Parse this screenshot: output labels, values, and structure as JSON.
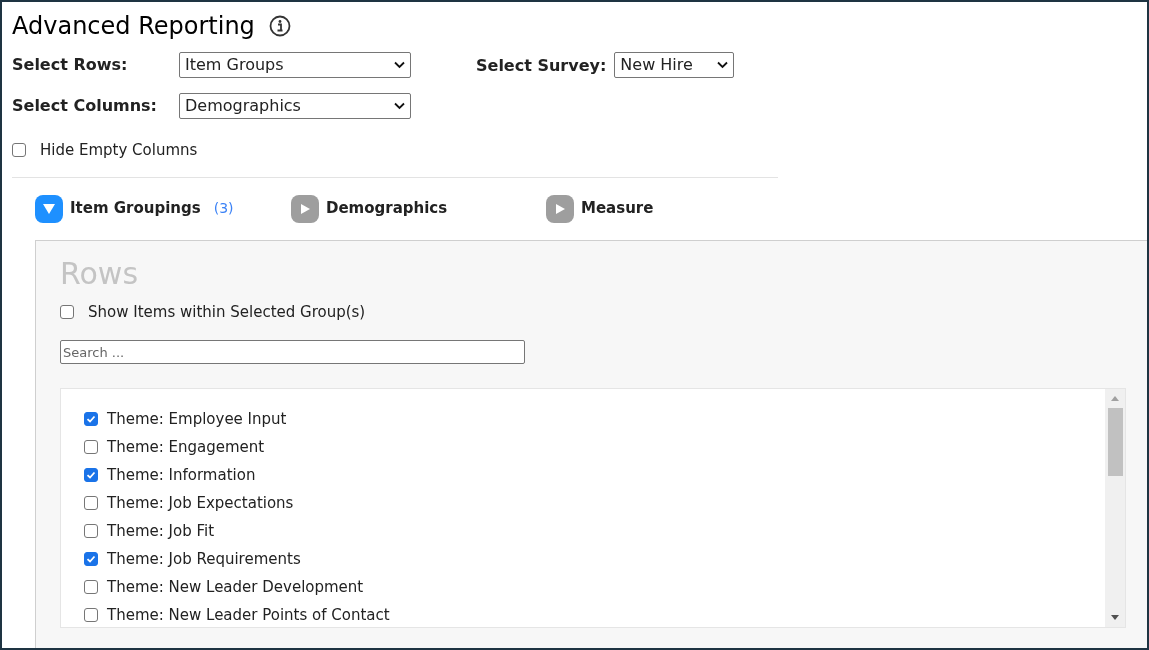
{
  "title": "Advanced Reporting",
  "selectors": [
    {
      "label": "Select Rows:",
      "value": "Item Groups"
    },
    {
      "label": "Select Columns:",
      "value": "Demographics"
    }
  ],
  "survey": {
    "label": "Select Survey:",
    "value": "New Hire"
  },
  "hide_empty_columns": {
    "label": "Hide Empty Columns",
    "checked": false
  },
  "tabs": [
    {
      "label": "Item Groupings",
      "count": "(3)",
      "expanded": true
    },
    {
      "label": "Demographics",
      "expanded": false
    },
    {
      "label": "Measure",
      "expanded": false
    }
  ],
  "panel": {
    "heading": "Rows",
    "show_items": {
      "label": "Show Items within Selected Group(s)",
      "checked": false
    },
    "search": {
      "placeholder": "Search ..."
    },
    "items": [
      {
        "label": "Theme: Employee Input",
        "checked": true
      },
      {
        "label": "Theme: Engagement",
        "checked": false
      },
      {
        "label": "Theme: Information",
        "checked": true
      },
      {
        "label": "Theme: Job Expectations",
        "checked": false
      },
      {
        "label": "Theme: Job Fit",
        "checked": false
      },
      {
        "label": "Theme: Job Requirements",
        "checked": true
      },
      {
        "label": "Theme: New Leader Development",
        "checked": false
      },
      {
        "label": "Theme: New Leader Points of Contact",
        "checked": false
      }
    ]
  }
}
